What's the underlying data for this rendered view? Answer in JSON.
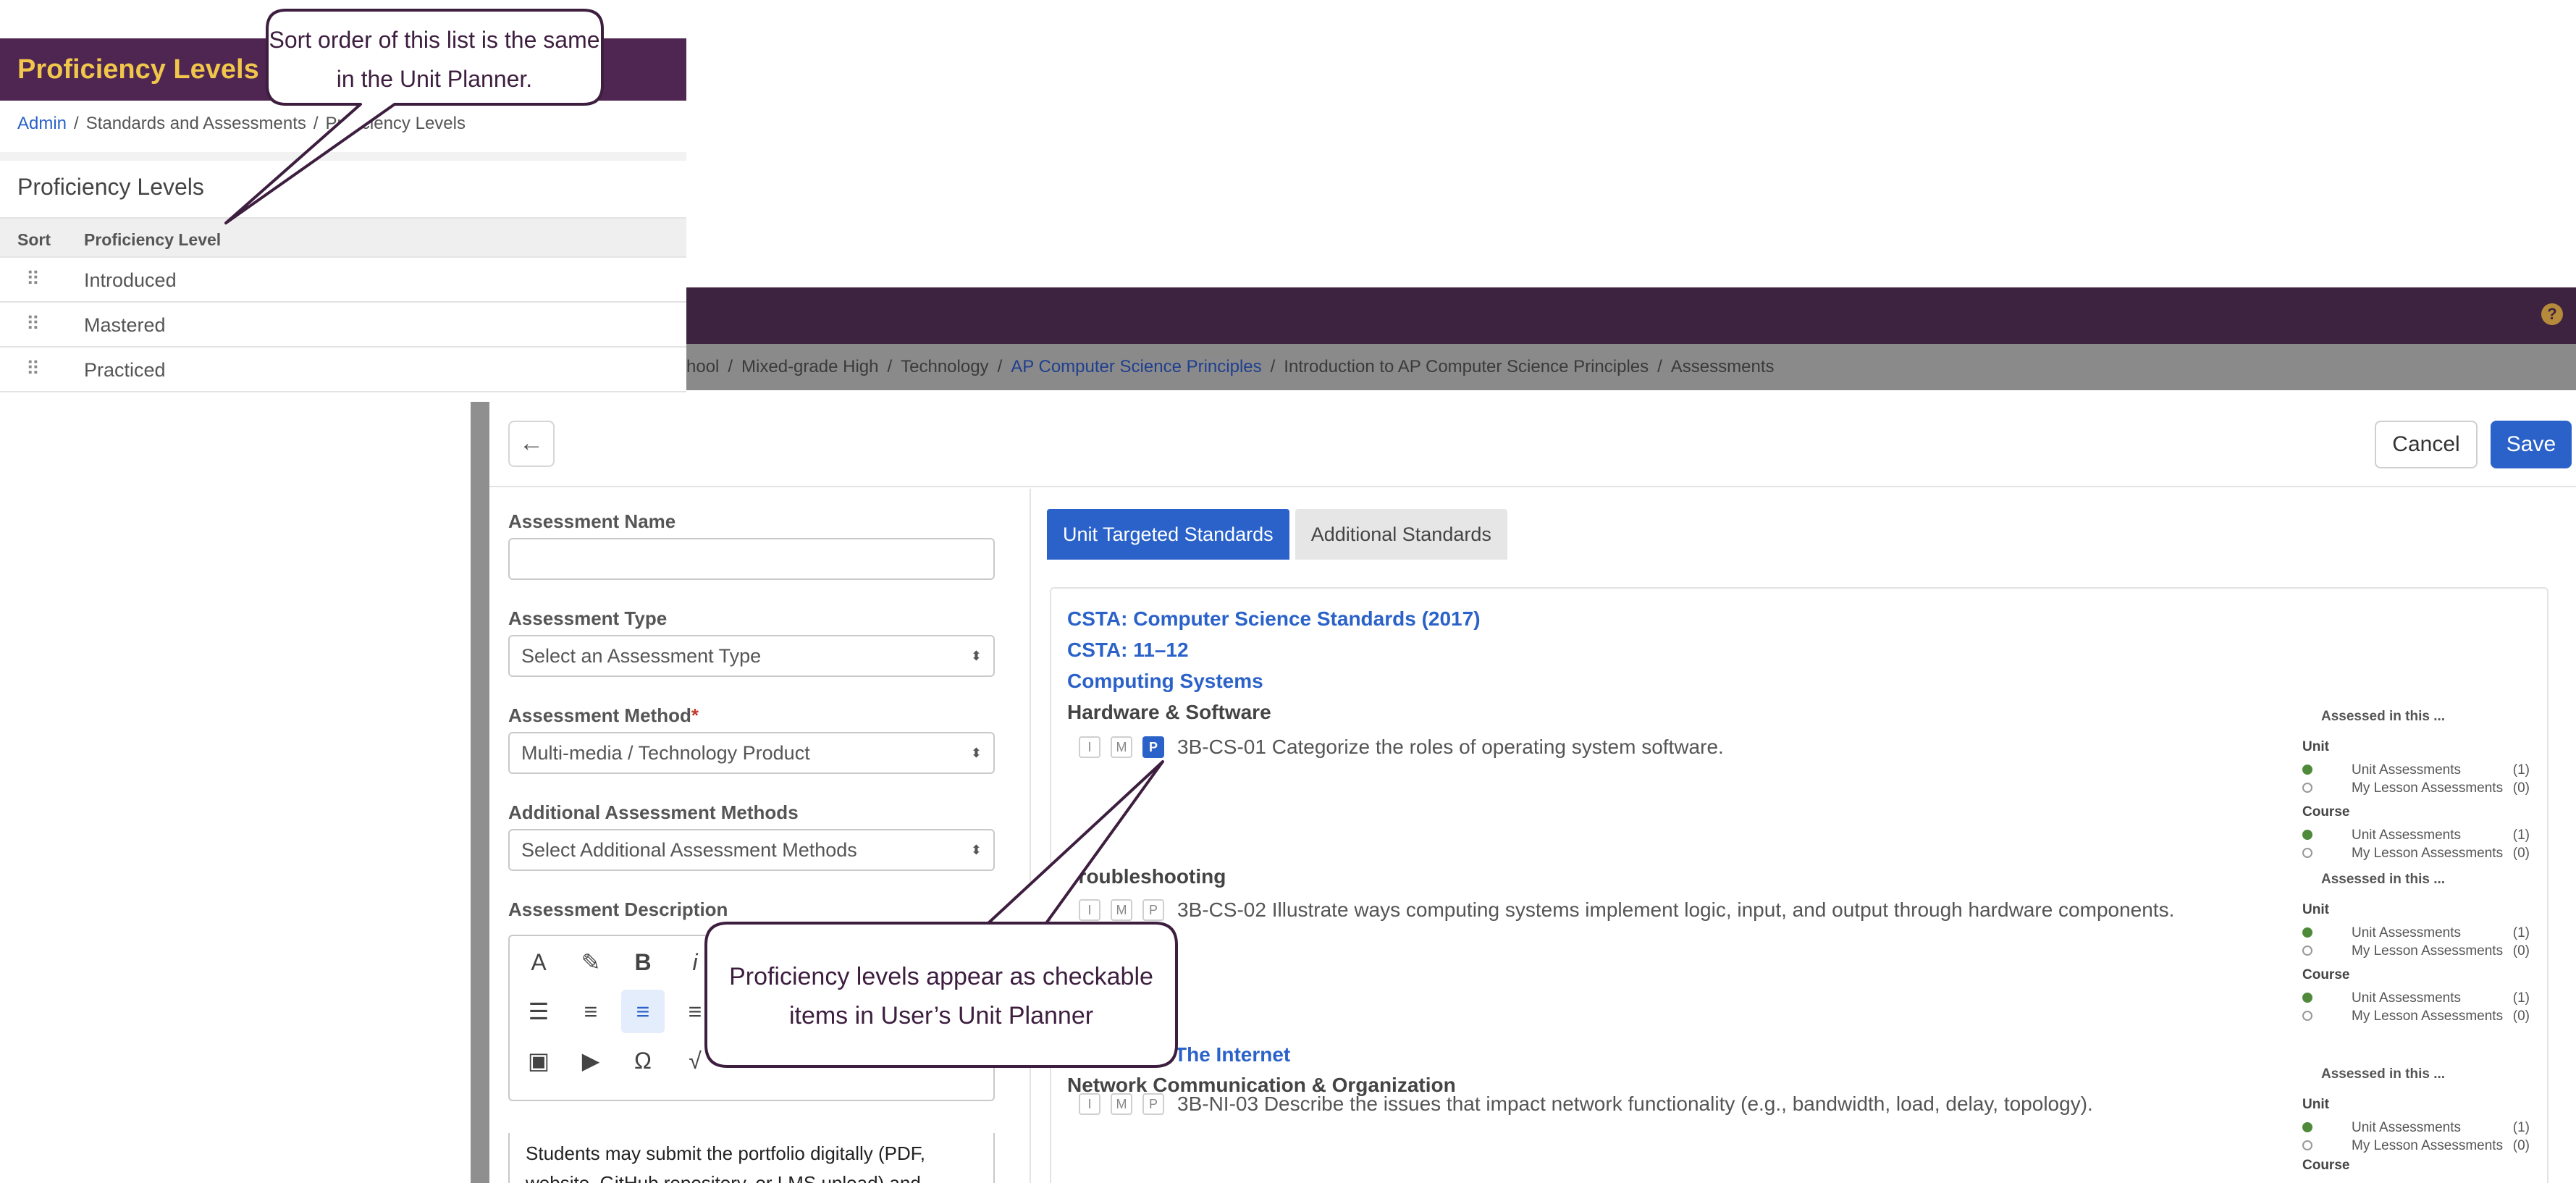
{
  "app": {
    "breadcrumb": [
      "hool",
      "Mixed-grade High",
      "Technology",
      "AP Computer Science Principles",
      "Introduction to AP Computer Science Principles",
      "Assessments"
    ],
    "help_icon": "?"
  },
  "modal": {
    "back_icon": "←",
    "cancel_label": "Cancel",
    "save_label": "Save",
    "form": {
      "name_label": "Assessment Name",
      "name_value": "",
      "type_label": "Assessment Type",
      "type_value": "Select an Assessment Type",
      "method_label": "Assessment Method",
      "method_required": "*",
      "method_value": "Multi-media / Technology Product",
      "additional_label": "Additional Assessment Methods",
      "additional_value": "Select Additional Assessment Methods",
      "description_label": "Assessment Description",
      "description_text": "Students may submit the portfolio digitally (PDF, website, GitHub repository, or LMS upload) and"
    },
    "toolbar_icons": [
      "font-color-icon",
      "highlighter-icon",
      "bold-icon",
      "italic-icon",
      "ordered-list-icon",
      "bullet-list-icon",
      "align-left-icon",
      "align-center-icon",
      "image-icon",
      "video-icon",
      "omega-icon",
      "sqrt-icon"
    ],
    "tabs": [
      "Unit Targeted Standards",
      "Additional Standards"
    ],
    "standards": {
      "framework": "CSTA: Computer Science Standards (2017)",
      "grade": "CSTA: 11–12",
      "concept_1": "Computing Systems",
      "sub_1": "Hardware & Software",
      "std_1": "3B-CS-01 Categorize the roles of operating system software.",
      "sub_2": "Troubleshooting",
      "std_2": "3B-CS-02 Illustrate ways computing systems implement logic, input, and output through hardware components.",
      "concept_2": "& The Internet",
      "sub_3": "Network Communication & Organization",
      "std_3": "3B-NI-03 Describe the issues that impact network functionality (e.g., bandwidth, load, delay, topology).",
      "checks": [
        "I",
        "M",
        "P"
      ]
    },
    "assessed": {
      "title": "Assessed in this ...",
      "unit": "Unit",
      "course": "Course",
      "unit_assessments": "Unit Assessments",
      "lesson_assessments": "My Lesson Assessments",
      "count_one": "(1)",
      "count_zero": "(0)"
    }
  },
  "proficiency_panel": {
    "header_title": "Proficiency Levels",
    "breadcrumb": [
      "Admin",
      "Standards and Assessments",
      "Proficiency Levels"
    ],
    "section_title": "Proficiency Levels",
    "col_sort": "Sort",
    "col_level": "Proficiency Level",
    "rows": [
      "Introduced",
      "Mastered",
      "Practiced"
    ]
  },
  "callouts": {
    "callout_1": "Sort order of this list is the same in the Unit Planner.",
    "callout_2": "Proficiency levels appear as checkable items in User’s Unit Planner"
  },
  "colors": {
    "purple_header": "#4e2651",
    "accent_blue": "#2a62c9",
    "title_gold": "#f0c64b",
    "callout_border": "#3d1e3f"
  }
}
